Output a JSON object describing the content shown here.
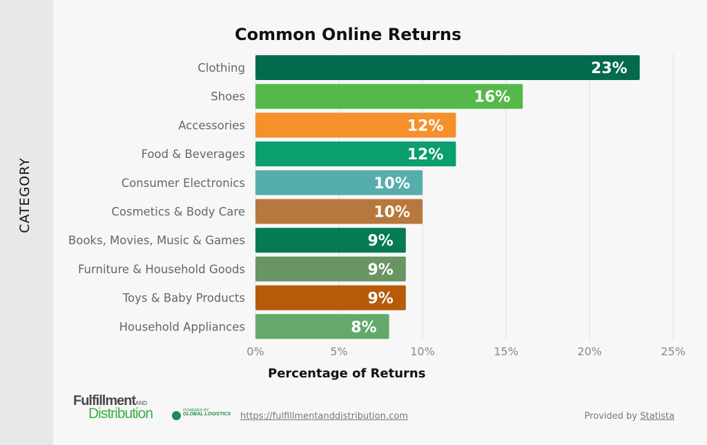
{
  "y_axis_title": "CATEGORY",
  "chart_data": {
    "type": "bar",
    "orientation": "horizontal",
    "title": "Common Online Returns",
    "xlabel": "Percentage of Returns",
    "ylabel": "CATEGORY",
    "xlim": [
      0,
      25
    ],
    "x_ticks": [
      0,
      5,
      10,
      15,
      20,
      25
    ],
    "x_tick_labels": [
      "0%",
      "5%",
      "10%",
      "15%",
      "20%",
      "25%"
    ],
    "grid": true,
    "categories": [
      "Clothing",
      "Shoes",
      "Accessories",
      "Food & Beverages",
      "Consumer Electronics",
      "Cosmetics & Body Care",
      "Books, Movies, Music & Games",
      "Furniture & Household Goods",
      "Toys & Baby Products",
      "Household Appliances"
    ],
    "values": [
      23,
      16,
      12,
      12,
      10,
      10,
      9,
      9,
      9,
      8
    ],
    "value_labels": [
      "23%",
      "16%",
      "12%",
      "12%",
      "10%",
      "10%",
      "9%",
      "9%",
      "9%",
      "8%"
    ],
    "colors": [
      "#036a4d",
      "#56b84a",
      "#f5902b",
      "#0b9e6e",
      "#55aeac",
      "#b8783d",
      "#057a55",
      "#699563",
      "#b65b08",
      "#64a96a"
    ]
  },
  "footer": {
    "logo_line1": "Fulfillment",
    "logo_and": "AND",
    "logo_line2": "Distribution",
    "logo_powered": "POWERED BY",
    "logo_company": "GLOBAL LOGISTICS",
    "url": "https://fulfillmentanddistribution.com",
    "provided_by": "Provided by",
    "provider": "Statista"
  }
}
